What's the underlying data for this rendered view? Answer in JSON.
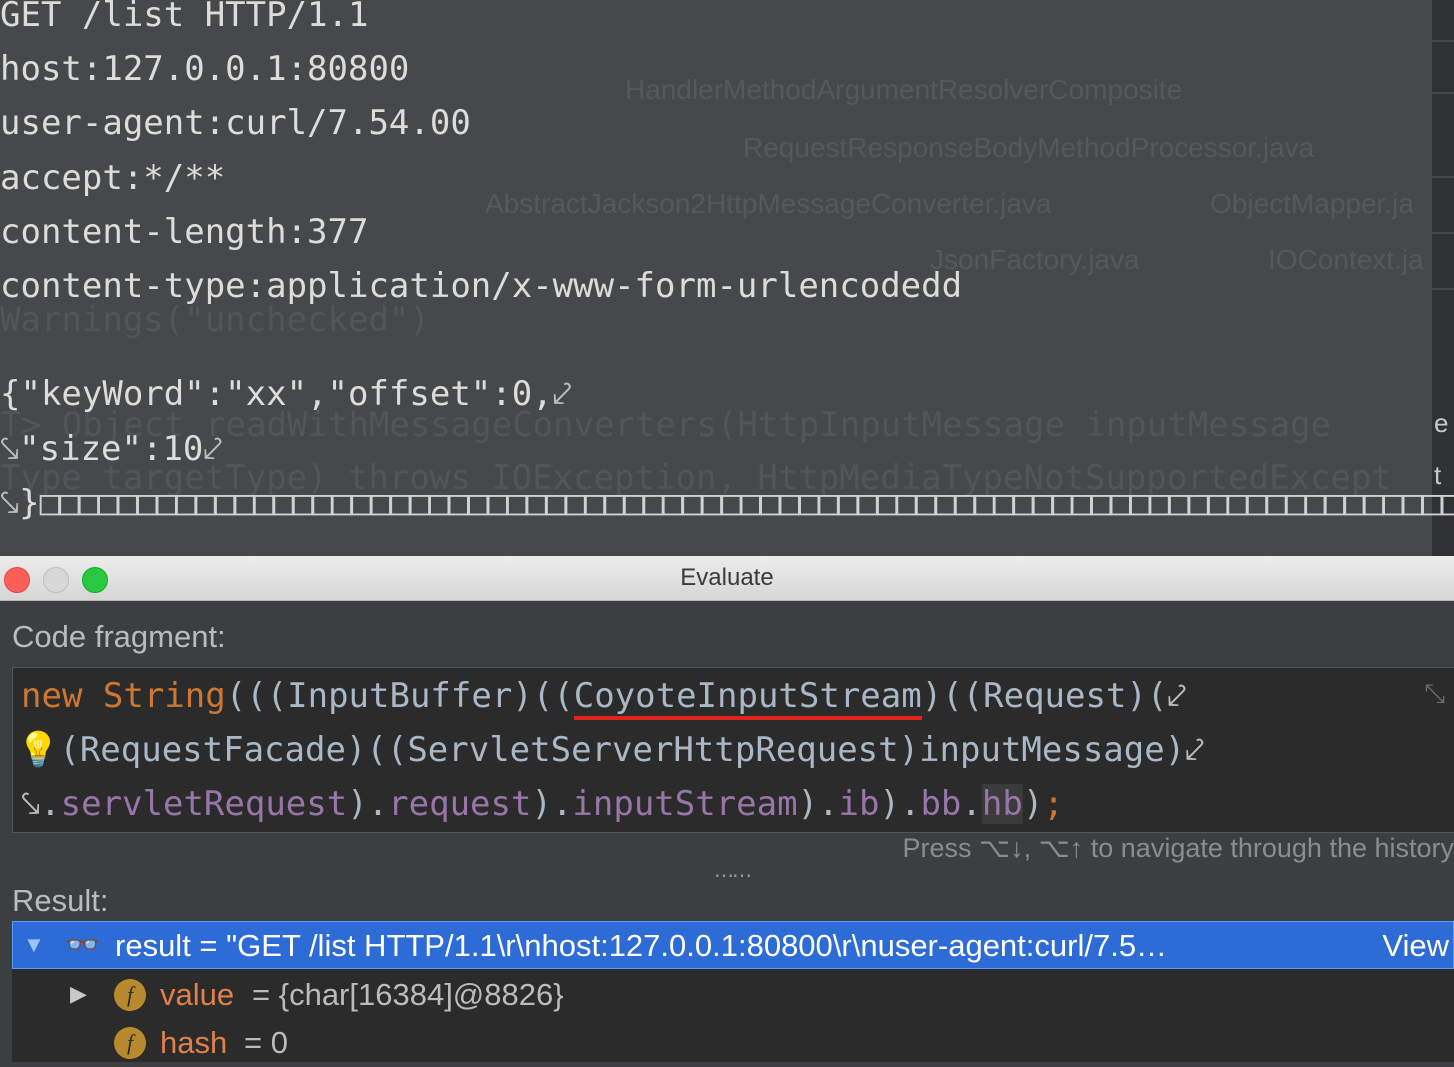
{
  "editor": {
    "request_lines": [
      "GET /list HTTP/1.1",
      "host:127.0.0.1:80800",
      "user-agent:curl/7.54.00",
      "accept:*/**",
      "content-length:377",
      "content-type:application/x-www-form-urlencodedd",
      "",
      "{\"keyWord\":\"xx\",\"offset\":0,",
      "\"size\":10",
      "}"
    ],
    "nul_run": "□□□□□□□□□□□□□□□□□□□□□□□□□□□□□□□□□□□□□□□□□□□□□□□□□□□□□□□□□□□□□□□□□□□□□□□□□□□□□□□□□□□□□□",
    "background_tabs": [
      "HandlerMethodArgumentResolverComposite",
      "RequestResponseBodyMethodProcessor.java",
      "AbstractJackson2HttpMessageConverter.java",
      "ObjectMapper.ja",
      "JsonFactory.java",
      "IOContext.ja"
    ],
    "background_code": [
      "Warnings(\"unchecked\")",
      "<T> Object readWithMessageConverters(HttpInputMessage inputMessage",
      "Type targetType) throws IOException, HttpMediaTypeNotSupportedExcept"
    ]
  },
  "window": {
    "title": "Evaluate"
  },
  "evaluate": {
    "code_label": "Code fragment:",
    "code": {
      "line1": {
        "kw": "new",
        "type": "String",
        "pre": "(((InputBuffer)((",
        "err": "CoyoteInputStream",
        "post": ")((Request)("
      },
      "line2": {
        "text": "(RequestFacade)((ServletServerHttpRequest)inputMessage)"
      },
      "line3": {
        "dot1": ".",
        "f1": "servletRequest",
        "sep1": ").",
        "f2": "request",
        "sep2": ").",
        "f3": "inputStream",
        "sep3": ").",
        "f4": "ib",
        "sep4": ").",
        "f5": "bb",
        "sep5": ".",
        "f6": "hb",
        "close": ")",
        "semi": ";"
      }
    },
    "history_hint": "Press ⌥↓, ⌥↑ to navigate through the history",
    "result_label": "Result:"
  },
  "result": {
    "name": "result",
    "eq": " = ",
    "value": "\"GET /list HTTP/1.1\\r\\nhost:127.0.0.1:80800\\r\\nuser-agent:curl/7.5…",
    "view_link": "View",
    "children": [
      {
        "name": "value",
        "eq": " = ",
        "value": "{char[16384]@8826}",
        "icon": "f"
      },
      {
        "name": "hash",
        "eq": " = ",
        "value": "0",
        "icon": "f"
      }
    ]
  },
  "icons": {
    "wrap": "⤦",
    "wrap_start": "⤥",
    "collapse": "⤡",
    "bulb": "💡",
    "glasses": "👓",
    "expanded": "▼",
    "collapsed": "▶",
    "splitter": "⋯⋯"
  },
  "colors": {
    "keyword": "#cc7832",
    "field": "#9876aa",
    "selection": "#2d6cd6",
    "error_underline": "#e0241c"
  }
}
